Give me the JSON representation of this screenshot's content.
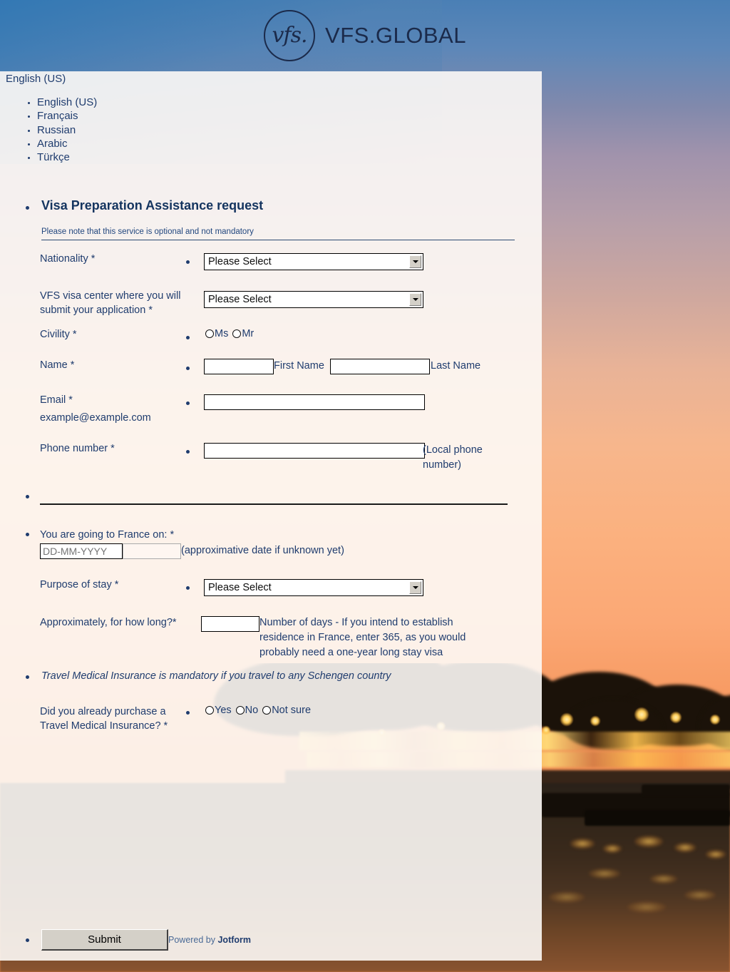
{
  "header": {
    "logo_mark": "vfs.",
    "logo_text": "VFS.GLOBAL"
  },
  "language": {
    "current": "English (US)",
    "options": [
      "English (US)",
      "Français",
      "Russian",
      "Arabic",
      "Türkçe"
    ]
  },
  "form": {
    "title": "Visa Preparation Assistance request",
    "note": "Please note that this service is optional and not mandatory",
    "fields": {
      "nationality": {
        "label": "Nationality *",
        "selected": "Please Select"
      },
      "visa_center": {
        "label": "VFS visa center where you will submit your application *",
        "selected": "Please Select"
      },
      "civility": {
        "label": "Civility *",
        "options": [
          "Ms",
          "Mr"
        ]
      },
      "name": {
        "label": "Name *",
        "first_value": "",
        "first_sublabel": "First Name",
        "last_value": "",
        "last_sublabel": "Last Name"
      },
      "email": {
        "label": "Email *",
        "sublabel": "example@example.com",
        "value": ""
      },
      "phone": {
        "label": "Phone number *",
        "sublabel": "(Local phone number)",
        "value": ""
      },
      "travel_date": {
        "label": "You are going to France on: *",
        "placeholder": "DD-MM-YYYY",
        "value": "",
        "hint": "(approximative date if unknown yet)"
      },
      "purpose": {
        "label": "Purpose of stay *",
        "selected": "Please Select"
      },
      "duration": {
        "label": "Approximately, for how long?",
        "required_mark": "*",
        "value": "",
        "hint": "Number of days - If you intend to establish residence in France, enter 365, as you would probably need a one-year long stay visa"
      },
      "insurance_note": "Travel Medical Insurance is mandatory if you travel to any Schengen country",
      "insurance": {
        "label": "Did you already purchase a Travel Medical Insurance? *",
        "options": [
          "Yes",
          "No",
          "Not sure"
        ]
      }
    },
    "submit_label": "Submit",
    "powered_by_prefix": "Powered by ",
    "powered_by_brand": "Jotform"
  },
  "colors": {
    "brand_navy": "#1b2a4a",
    "label_blue": "#1f3c6e",
    "panel_bg": "#fdfaf6",
    "sunset_orange": "#f7a86a",
    "sky_blue": "#4a7fb5"
  }
}
